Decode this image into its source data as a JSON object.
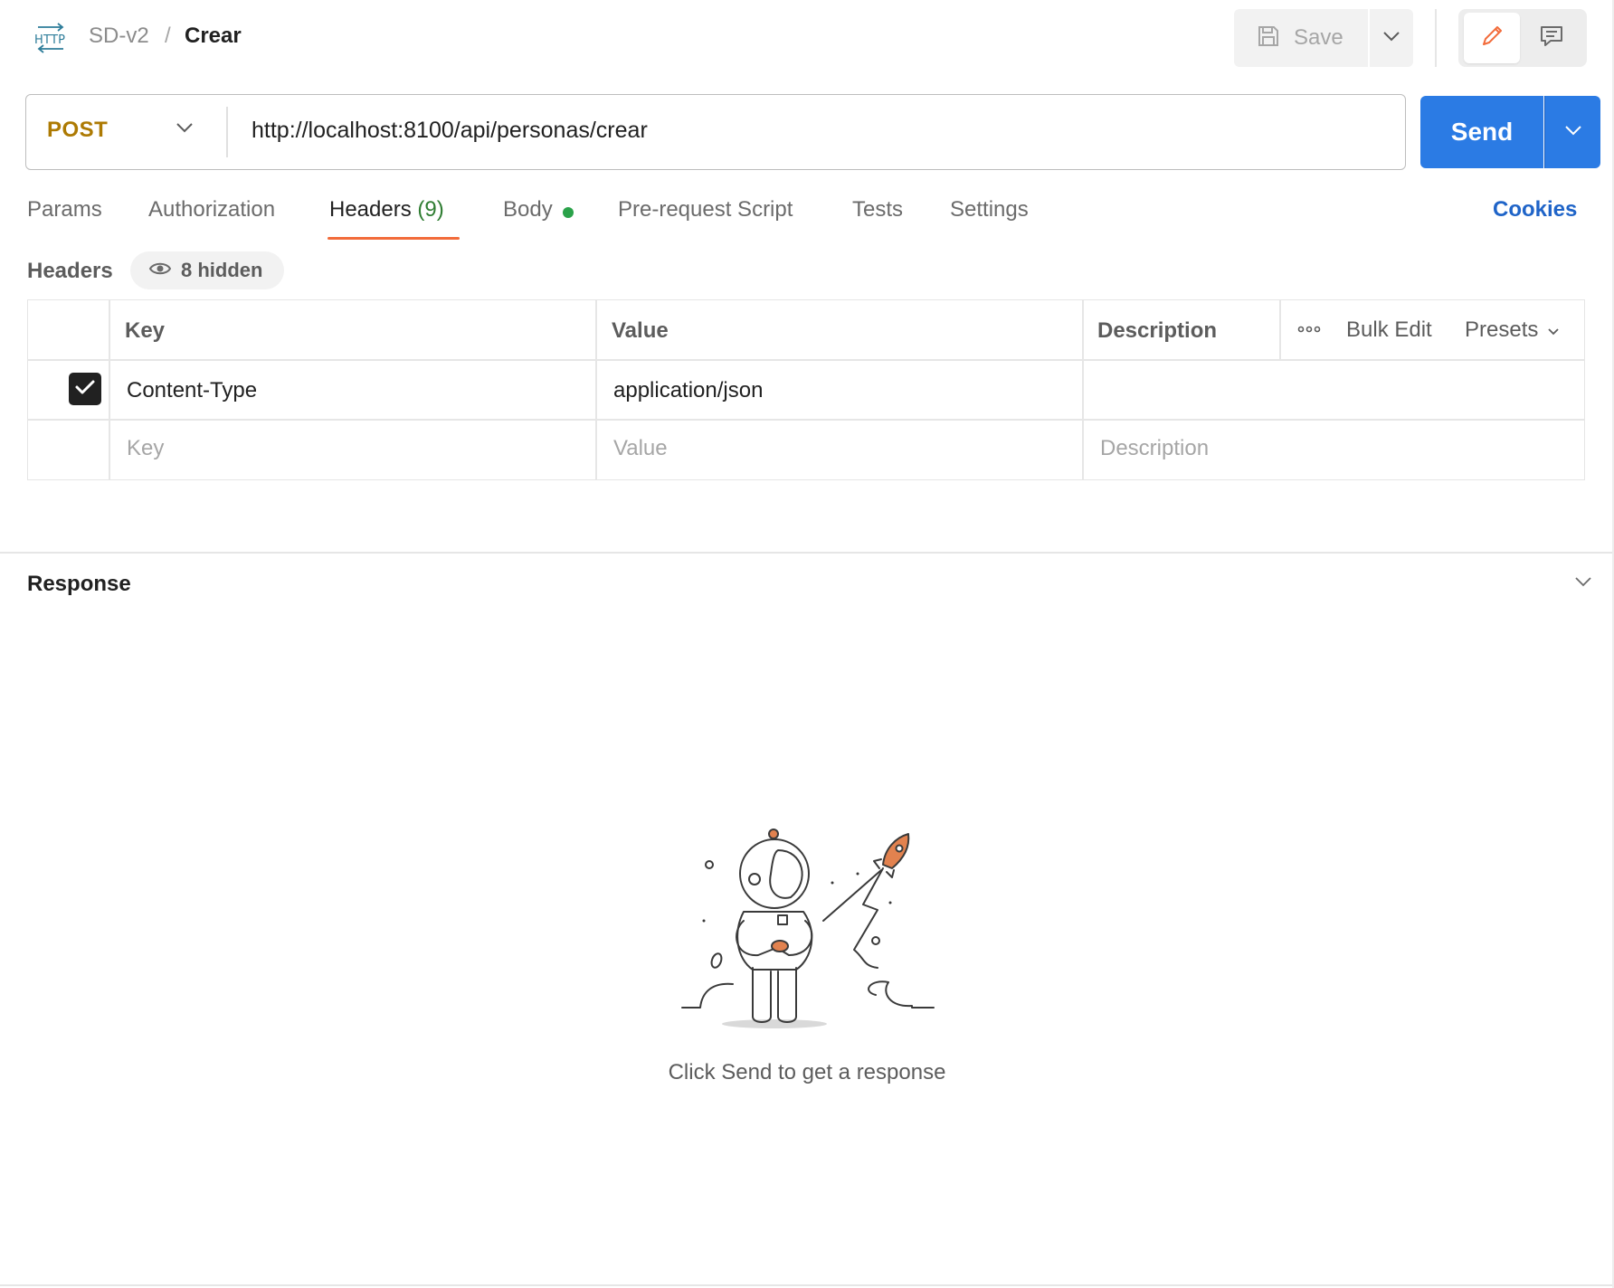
{
  "breadcrumb": {
    "icon": "http-icon",
    "parent": "SD-v2",
    "separator": "/",
    "current": "Crear"
  },
  "toolbar": {
    "save_label": "Save",
    "save_icon": "save-icon",
    "mode_edit_icon": "pencil-icon",
    "mode_comment_icon": "comment-icon"
  },
  "request": {
    "method": "POST",
    "url": "http://localhost:8100/api/personas/crear",
    "send_label": "Send"
  },
  "tabs": [
    {
      "label": "Params"
    },
    {
      "label": "Authorization"
    },
    {
      "label": "Headers",
      "count": "(9)"
    },
    {
      "label": "Body"
    },
    {
      "label": "Pre-request Script"
    },
    {
      "label": "Tests"
    },
    {
      "label": "Settings"
    }
  ],
  "active_tab": "Headers",
  "cookies_label": "Cookies",
  "headers_section": {
    "title": "Headers",
    "hidden_label": "8 hidden",
    "columns": [
      "Key",
      "Value",
      "Description"
    ],
    "actions": {
      "bulk_edit": "Bulk Edit",
      "presets": "Presets"
    },
    "rows": [
      {
        "checked": true,
        "key": "Content-Type",
        "value": "application/json",
        "description": ""
      }
    ],
    "placeholders": {
      "key": "Key",
      "value": "Value",
      "description": "Description"
    }
  },
  "response": {
    "title": "Response",
    "empty_message": "Click Send to get a response"
  },
  "colors": {
    "method": "#ad7a03",
    "send": "#2b7be4",
    "tab_underline": "#f26b3a",
    "body_dot": "#2aa24a",
    "cookies": "#1f64c8",
    "headers_count": "#2f7d32"
  }
}
